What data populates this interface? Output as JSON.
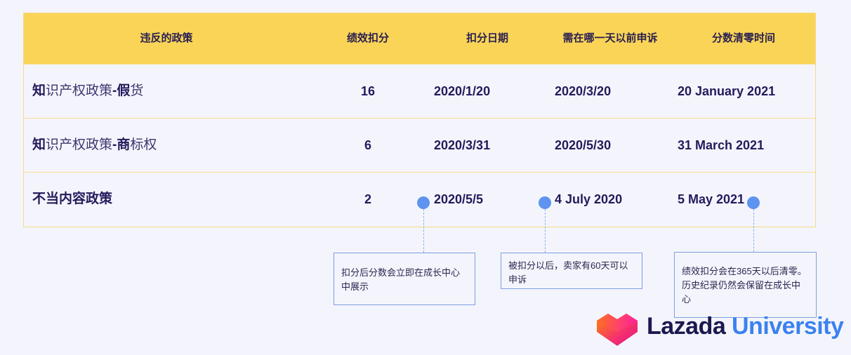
{
  "table": {
    "headers": [
      "违反的政策",
      "绩效扣分",
      "扣分日期",
      "需在哪一天以前申诉",
      "分数清零时间"
    ],
    "rows": [
      {
        "policy_bold": "知",
        "policy_light": "识产权政策",
        "policy_dash": "-",
        "policy_bold2": "假",
        "policy_light2": "货",
        "points": "16",
        "deduct_date": "2020/1/20",
        "appeal_by": "2020/3/20",
        "reset_date": "20 January 2021"
      },
      {
        "policy_bold": "知",
        "policy_light": "识产权政策",
        "policy_dash": "-",
        "policy_bold2": "商",
        "policy_light2": "标权",
        "points": "6",
        "deduct_date": "2020/3/31",
        "appeal_by": "2020/5/30",
        "reset_date": "31 March 2021"
      },
      {
        "policy_bold": "不当内容政策",
        "policy_light": "",
        "policy_dash": "",
        "policy_bold2": "",
        "policy_light2": "",
        "points": "2",
        "deduct_date": "2020/5/5",
        "appeal_by": "4 July 2020",
        "reset_date": "5 May 2021"
      }
    ]
  },
  "notes": [
    "扣分后分数会立即在成长中心中展示",
    "被扣分以后，卖家有60天可以申诉",
    "绩效扣分会在365天以后清零。历史纪录仍然会保留在成长中心"
  ],
  "logo": {
    "brand": "Lazada",
    "suffix": "University"
  },
  "colors": {
    "header_bg": "#fad457",
    "accent_dot": "#5e93f0",
    "text_dark": "#221b5c",
    "logo_blue": "#3b82f0"
  }
}
